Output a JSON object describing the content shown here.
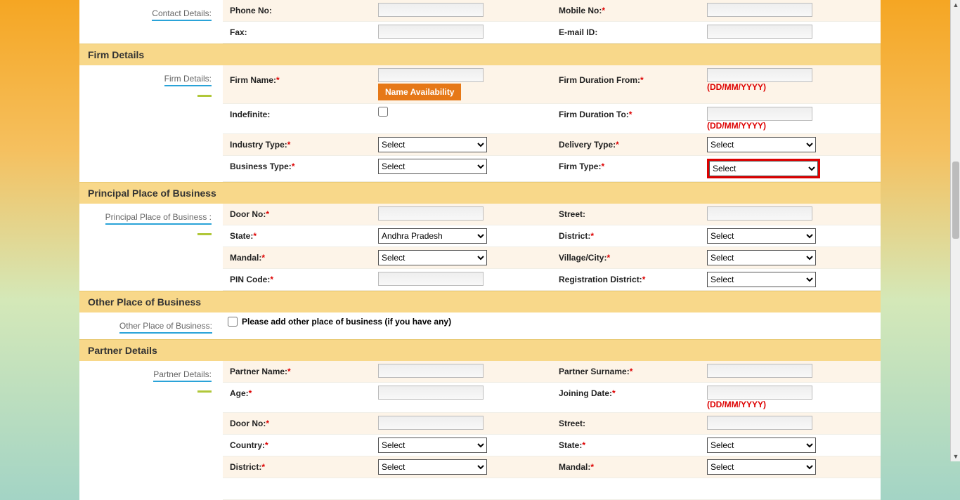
{
  "contact": {
    "sub_label": "Contact Details:",
    "phone_label": "Phone No:",
    "mobile_label": "Mobile No:",
    "fax_label": "Fax:",
    "email_label": "E-mail ID:"
  },
  "firm": {
    "header": "Firm Details",
    "sub_label": "Firm Details:",
    "name_label": "Firm Name:",
    "name_avail_btn": "Name Availability",
    "duration_from_label": "Firm Duration From:",
    "indefinite_label": "Indefinite:",
    "duration_to_label": "Firm Duration To:",
    "date_hint": "(DD/MM/YYYY)",
    "industry_label": "Industry Type:",
    "delivery_label": "Delivery Type:",
    "business_label": "Business Type:",
    "firm_type_label": "Firm Type:",
    "select_default": "Select"
  },
  "ppb": {
    "header": "Principal Place of Business",
    "sub_label": "Principal Place of Business :",
    "door_label": "Door No:",
    "street_label": "Street:",
    "state_label": "State:",
    "state_value": "Andhra Pradesh",
    "district_label": "District:",
    "mandal_label": "Mandal:",
    "village_label": "Village/City:",
    "pin_label": "PIN Code:",
    "reg_dist_label": "Registration District:",
    "select_default": "Select"
  },
  "opb": {
    "header": "Other Place of Business",
    "sub_label": "Other Place of Business:",
    "checkbox_label": "Please add other place of business (if you have any)"
  },
  "partner": {
    "header": "Partner Details",
    "sub_label": "Partner Details:",
    "name_label": "Partner Name:",
    "surname_label": "Partner Surname:",
    "age_label": "Age:",
    "joining_label": "Joining Date:",
    "date_hint": "(DD/MM/YYYY)",
    "door_label": "Door No:",
    "street_label": "Street:",
    "country_label": "Country:",
    "state_label": "State:",
    "district_label": "District:",
    "mandal_label": "Mandal:",
    "select_default": "Select"
  }
}
